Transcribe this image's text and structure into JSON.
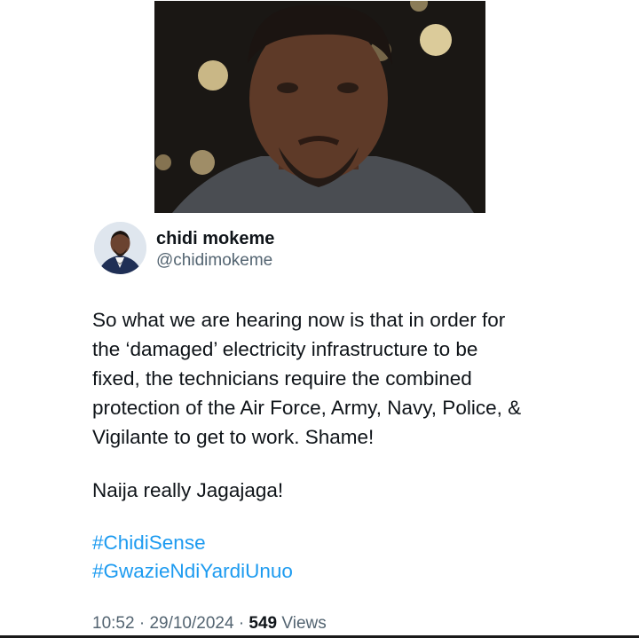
{
  "tweet": {
    "display_name": "chidi mokeme",
    "handle": "@chidimokeme",
    "text_lines": [
      "So what we are hearing now is that in order for",
      "the ‘damaged’ electricity infrastructure to be",
      "fixed, the technicians require the combined",
      "protection of the Air Force, Army, Navy, Police, &",
      "Vigilante to get to work. Shame!"
    ],
    "text_second_paragraph": "Naija really Jagajaga!",
    "hashtags": [
      "#ChidiSense",
      "#GwazieNdiYardiUnuo"
    ],
    "time": "10:52",
    "separator": "·",
    "date": "29/10/2024",
    "views_count": "549",
    "views_label": "Views"
  },
  "colors": {
    "text": "#0f1419",
    "secondary": "#536471",
    "link": "#1d9bf0"
  },
  "icons": {
    "photo": "man-portrait-photo",
    "avatar": "user-avatar"
  }
}
